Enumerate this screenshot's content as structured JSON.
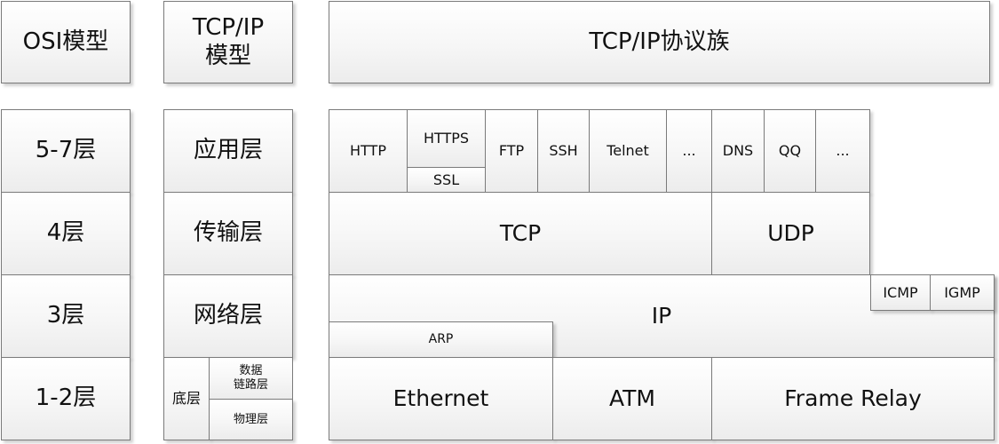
{
  "headers": {
    "osi_model": "OSI模型",
    "tcpip_model": "TCP/IP\n模型",
    "tcpip_suite": "TCP/IP协议族"
  },
  "osi_layers": [
    "5-7层",
    "4层",
    "3层",
    "1-2层"
  ],
  "tcpip_layers": {
    "application": "应用层",
    "transport": "传输层",
    "network": "网络层",
    "bottom": "底层",
    "datalink": "数据\n链路层",
    "physical": "物理层"
  },
  "protocols": {
    "application": {
      "http": "HTTP",
      "https": "HTTPS",
      "ssl": "SSL",
      "ftp": "FTP",
      "ssh": "SSH",
      "telnet": "Telnet",
      "ellipsis_tcp": "...",
      "dns": "DNS",
      "qq": "QQ",
      "ellipsis_udp": "..."
    },
    "transport": {
      "tcp": "TCP",
      "udp": "UDP"
    },
    "network": {
      "ip": "IP",
      "icmp": "ICMP",
      "igmp": "IGMP",
      "arp": "ARP"
    },
    "link": {
      "ethernet": "Ethernet",
      "atm": "ATM",
      "frame_relay": "Frame Relay"
    }
  }
}
